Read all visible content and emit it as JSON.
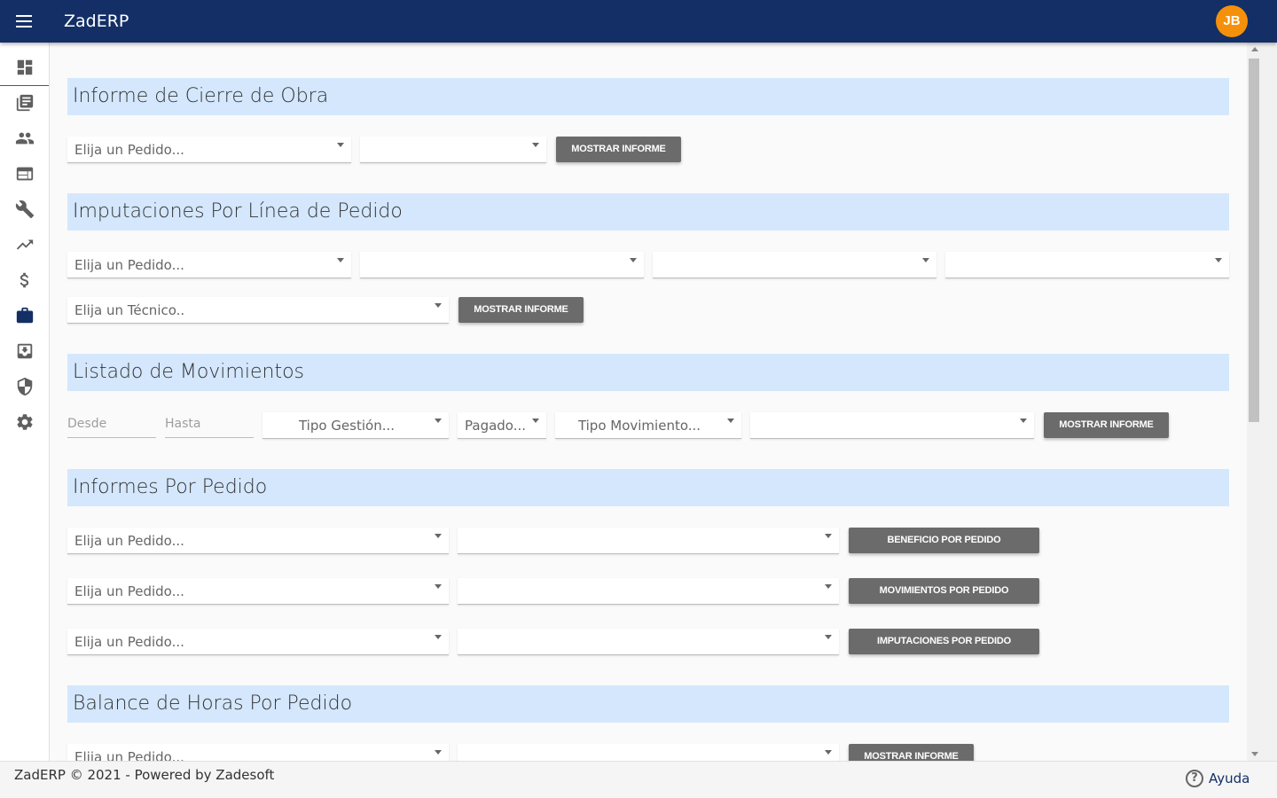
{
  "app": {
    "title": "ZadERP",
    "user_initials": "JB",
    "accent": "#132f66",
    "avatar_color": "#f5900b"
  },
  "sidebar": {
    "items": [
      {
        "icon": "dashboard-icon"
      },
      {
        "icon": "library-icon"
      },
      {
        "icon": "people-icon"
      },
      {
        "icon": "web-icon"
      },
      {
        "icon": "wrench-icon"
      },
      {
        "icon": "trending-up-icon"
      },
      {
        "icon": "dollar-icon"
      },
      {
        "icon": "briefcase-icon"
      },
      {
        "icon": "archive-icon"
      },
      {
        "icon": "shield-icon"
      },
      {
        "icon": "gear-icon"
      }
    ]
  },
  "sections": {
    "cierre": {
      "title": "Informe de Cierre de Obra",
      "pedido_placeholder": "Elija un Pedido...",
      "second_value": "",
      "button": "MOSTRAR INFORME"
    },
    "imputaciones": {
      "title": "Imputaciones Por Línea de Pedido",
      "pedido_placeholder": "Elija un Pedido...",
      "field2": "",
      "field3": "",
      "field4": "",
      "tecnico_placeholder": "Elija un Técnico..",
      "button": "MOSTRAR INFORME"
    },
    "movimientos": {
      "title": "Listado de Movimientos",
      "desde": "Desde",
      "hasta": "Hasta",
      "tipo_gestion": "Tipo Gestión...",
      "pagado": "Pagado...",
      "tipo_movimiento": "Tipo Movimiento...",
      "extra": "",
      "button": "MOSTRAR INFORME"
    },
    "por_pedido": {
      "title": "Informes Por Pedido",
      "rows": [
        {
          "placeholder": "Elija un Pedido...",
          "value": "",
          "button": "BENEFICIO POR PEDIDO"
        },
        {
          "placeholder": "Elija un Pedido...",
          "value": "",
          "button": "MOVIMIENTOS POR PEDIDO"
        },
        {
          "placeholder": "Elija un Pedido...",
          "value": "",
          "button": "IMPUTACIONES POR PEDIDO"
        }
      ]
    },
    "balance": {
      "title": "Balance de Horas Por Pedido",
      "pedido_placeholder": "Elija un Pedido...",
      "value": "",
      "button": "MOSTRAR INFORME"
    }
  },
  "footer": {
    "text": "ZadERP © 2021 - Powered by Zadesoft",
    "help": "Ayuda"
  }
}
